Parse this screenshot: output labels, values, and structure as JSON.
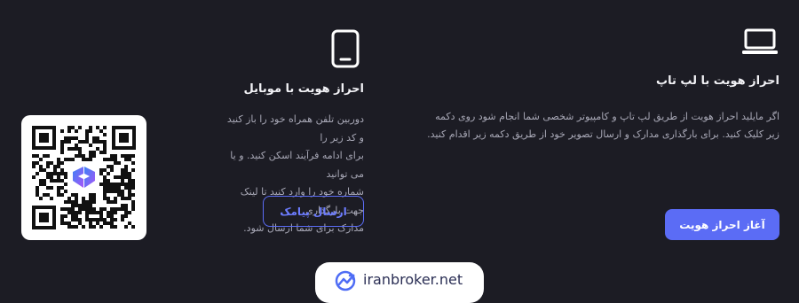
{
  "laptop": {
    "icon": "laptop-icon",
    "title": "احراز هویت با لپ تاپ",
    "description_line1": "اگر مایلید احراز هویت از طریق لپ تاپ و کامپیوتر شخصی شما انجام شود روی دکمه",
    "description_line2": "زیر کلیک کنید. برای بارگذاری مدارک و ارسال تصویر خود از طریق دکمه زیر اقدام کنید.",
    "button_label": "آغاز احراز هویت"
  },
  "mobile": {
    "icon": "smartphone-icon",
    "title": "احراز هویت با موبایل",
    "description_lines": [
      "دوربین تلفن همراه خود را باز کنید و کد زیر را",
      "برای ادامه فرآیند اسکن کنید. و یا می توانید",
      "شماره خود را وارد کنید تا لینک جهت بارگذاری",
      "مدارک برای شما ارسال شود."
    ],
    "button_label": "ارسال پیامک"
  },
  "qr": {
    "icon": "qr-code-icon",
    "center_logo": "brand-heart-logo-icon",
    "logo_color_start": "#3b82f6",
    "logo_color_end": "#a855f7"
  },
  "watermark": {
    "icon": "chart-trend-icon",
    "text": "iranbroker.net"
  },
  "colors": {
    "background": "#1c1c24",
    "accent": "#5b6cf5",
    "muted_text": "#a8a8b6"
  }
}
